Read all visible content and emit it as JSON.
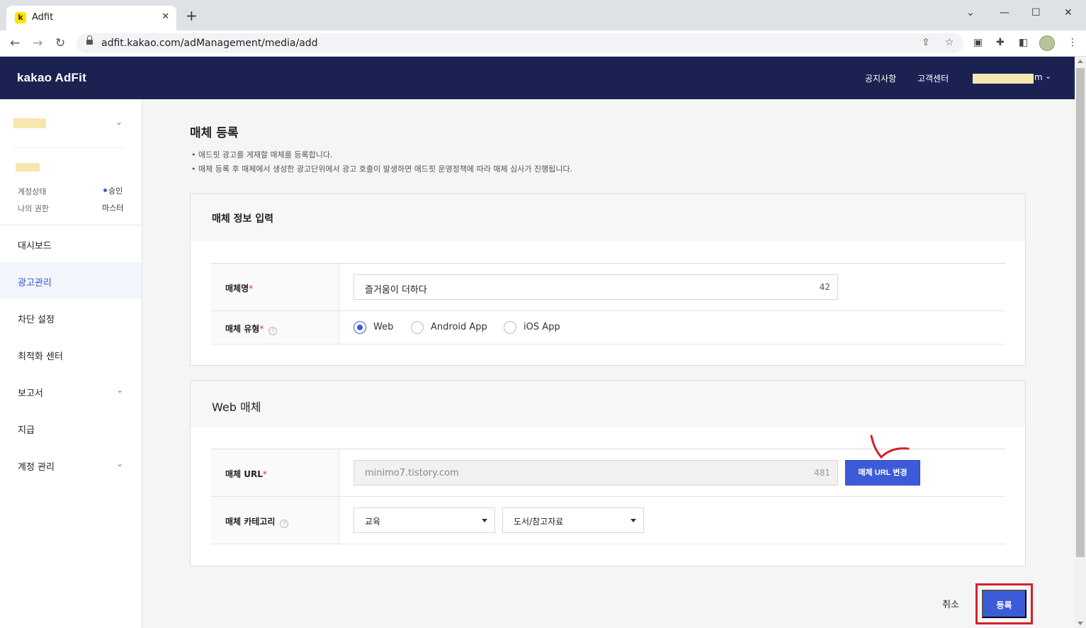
{
  "browser": {
    "tab_title": "Adfit",
    "tab_favicon_letter": "k",
    "url": "adfit.kakao.com/adManagement/media/add",
    "icons": [
      "back-icon",
      "forward-icon",
      "reload-icon",
      "lock-icon",
      "share-icon",
      "star-icon",
      "media-icon",
      "extensions-icon",
      "sidepanel-icon",
      "profile-avatar",
      "more-icon",
      "minimize-icon",
      "maximize-icon",
      "close-icon",
      "new-tab-icon",
      "tab-search-icon"
    ]
  },
  "header": {
    "logo": "kakao AdFit",
    "links": [
      "공지사항",
      "고객센터"
    ],
    "user_suffix": "m",
    "bg_color": "#1b2150"
  },
  "sidebar": {
    "account": {
      "status_label": "계정상태",
      "status_value": "승인",
      "role_label": "나의 권한",
      "role_value": "마스터"
    },
    "menu": [
      {
        "label": "대시보드",
        "active": false,
        "expandable": false
      },
      {
        "label": "광고관리",
        "active": true,
        "expandable": false
      },
      {
        "label": "차단 설정",
        "active": false,
        "expandable": false
      },
      {
        "label": "최적화 센터",
        "active": false,
        "expandable": false
      },
      {
        "label": "보고서",
        "active": false,
        "expandable": true
      },
      {
        "label": "지급",
        "active": false,
        "expandable": false
      },
      {
        "label": "계정 관리",
        "active": false,
        "expandable": true
      }
    ]
  },
  "page": {
    "title": "매체 등록",
    "descriptions": [
      "• 애드핏 광고를 게재할 매체를 등록합니다.",
      "• 매체 등록 후 매체에서 생성한 광고단위에서 광고 호출이 발생하면 애드핏 운영정책에 따라 매체 심사가 진행됩니다."
    ]
  },
  "media_info": {
    "section_title": "매체 정보 입력",
    "name_label": "매체명",
    "name_value": "즐거움이 더하다",
    "name_count": "42",
    "type_label": "매체 유형",
    "type_options": [
      "Web",
      "Android App",
      "iOS App"
    ],
    "type_selected": "Web"
  },
  "web_media": {
    "section_title": "Web 매체",
    "url_label": "매체 URL",
    "url_value": "minimo7.tistory.com",
    "url_count": "481",
    "change_url_button": "매체 URL 변경",
    "category_label": "매체 카테고리",
    "category_primary": "교육",
    "category_secondary": "도서/참고자료"
  },
  "actions": {
    "cancel": "취소",
    "submit": "등록"
  },
  "colors": {
    "accent": "#3d5bd9",
    "required": "#e03030",
    "highlight_box": "#d4202a"
  }
}
